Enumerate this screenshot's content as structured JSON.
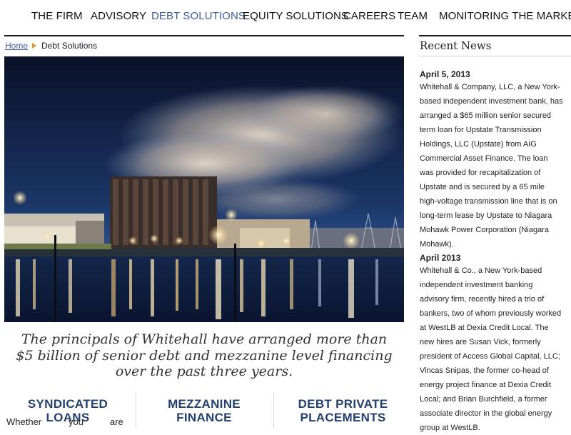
{
  "nav": {
    "items": [
      "THE FIRM",
      "ADVISORY",
      "DEBT SOLUTIONS",
      "EQUITY SOLUTIONS",
      "CAREERS",
      "TEAM",
      "MONITORING THE MARKETS"
    ],
    "active": "DEBT SOLUTIONS",
    "active_color": "#3d5f98"
  },
  "breadcrumb": {
    "home": "Home",
    "current": "Debt Solutions"
  },
  "tagline": {
    "lines": [
      "The principals of Whitehall have arranged more than",
      "$5 billion of senior debt and mezzanine level financing",
      "over the past three years."
    ]
  },
  "columns": [
    {
      "title_lines": [
        "SYNDICATED LOANS"
      ],
      "text_words": [
        "Whether",
        "you",
        "are"
      ]
    },
    {
      "title_lines": [
        "MEZZANINE",
        "FINANCE"
      ]
    },
    {
      "title_lines": [
        "DEBT PRIVATE",
        "PLACEMENTS"
      ]
    }
  ],
  "news": {
    "heading": "Recent News",
    "items": [
      {
        "date": "April 5, 2013",
        "lines": [
          "Whitehall & Company, LLC, a New York-",
          "based independent investment bank, has",
          "arranged a $65 million senior secured",
          "term loan for Upstate Transmission",
          "Holdings, LLC (Upstate) from AIG",
          "Commercial Asset Finance. The loan",
          "was provided for recapitalization of",
          "Upstate and is secured by a 65 mile",
          "high-voltage transmission line that is on",
          "long-term lease by Upstate to Niagara",
          "Mohawk Power Corporation (Niagara",
          "Mohawk)."
        ]
      },
      {
        "date": "April 2013",
        "lines": [
          "Whitehall & Co., a New York-based",
          "independent investment banking",
          "advisory firm, recently hired a trio of",
          "bankers, two of whom previously worked",
          "at WestLB at Dexia Credit Local. The",
          "new hires are Susan Vick, formerly",
          "president of Access Global Capital, LLC;",
          "Vincas Snipas, the former co-head of",
          "energy project finance at Dexia Credit",
          "Local; and Brian Burchfield, a former",
          "associate director in the global energy",
          "group at WestLB."
        ]
      }
    ]
  },
  "colors": {
    "link": "#3d5f98",
    "heading": "#24406e",
    "breadcrumb_arrow": "#e8952a"
  }
}
